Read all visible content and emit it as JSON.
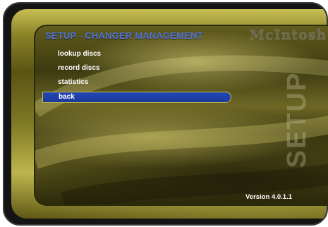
{
  "header": {
    "title": "SETUP - CHANGER MANAGEMENT",
    "brand": "McIntosh"
  },
  "menu": {
    "items": [
      {
        "label": "lookup discs",
        "selected": false
      },
      {
        "label": "record discs",
        "selected": false
      },
      {
        "label": "statistics",
        "selected": false
      },
      {
        "label": "back",
        "selected": true
      }
    ]
  },
  "side_label": "SETUP",
  "footer": {
    "version": "Version 4.0.1.1"
  },
  "colors": {
    "title": "#4f74d8",
    "selection": "#2148b6",
    "bezel_gold": "#bdb34d"
  }
}
